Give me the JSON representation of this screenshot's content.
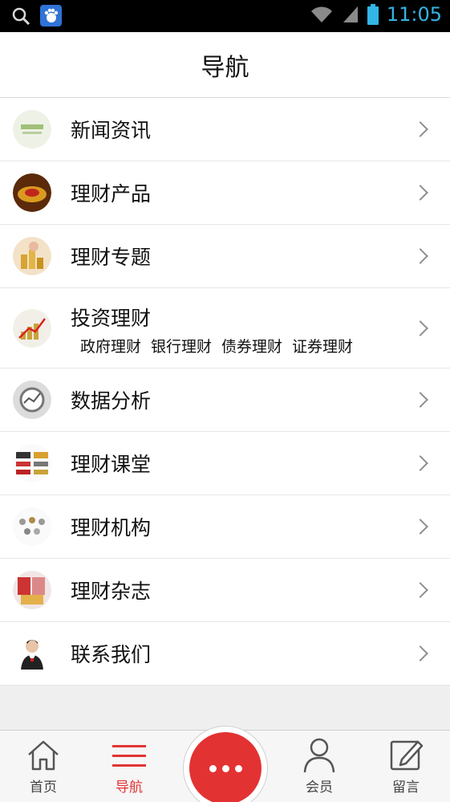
{
  "status_bar": {
    "time": "11:05"
  },
  "header": {
    "title": "导航"
  },
  "menu": {
    "items": [
      {
        "label": "新闻资讯"
      },
      {
        "label": "理财产品"
      },
      {
        "label": "理财专题"
      },
      {
        "label": "投资理财",
        "sublinks": [
          "政府理财",
          "银行理财",
          "债券理财",
          "证券理财"
        ]
      },
      {
        "label": "数据分析"
      },
      {
        "label": "理财课堂"
      },
      {
        "label": "理财机构"
      },
      {
        "label": "理财杂志"
      },
      {
        "label": "联系我们"
      }
    ]
  },
  "tabbar": {
    "tabs": [
      {
        "label": "首页",
        "icon": "home-icon"
      },
      {
        "label": "导航",
        "icon": "menu-icon",
        "active": true
      },
      {
        "label": "会员",
        "icon": "user-icon"
      },
      {
        "label": "留言",
        "icon": "edit-icon"
      }
    ]
  },
  "colors": {
    "accent": "#e33232",
    "status_text": "#33b5e5"
  }
}
